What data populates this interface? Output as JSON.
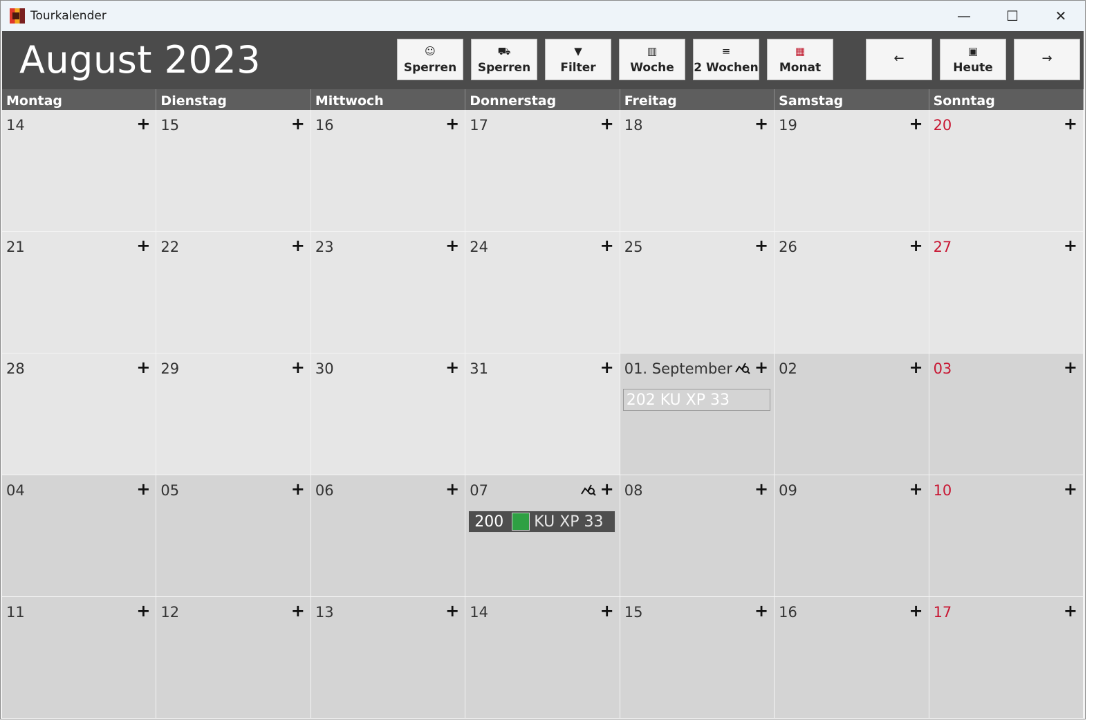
{
  "window": {
    "title": "Tourkalender",
    "controls": {
      "minimize": "—",
      "maximize": "☐",
      "close": "✕"
    }
  },
  "header": {
    "month_title": "August 2023"
  },
  "toolbar": {
    "buttons": [
      {
        "id": "sperren-driver",
        "icon": "person-face-icon",
        "glyph": "☺",
        "label": "Sperren"
      },
      {
        "id": "sperren-truck",
        "icon": "truck-icon",
        "glyph": "⛟",
        "label": "Sperren"
      },
      {
        "id": "filter",
        "icon": "filter-icon",
        "glyph": "▼",
        "label": "Filter"
      },
      {
        "id": "woche",
        "icon": "week-columns-icon",
        "glyph": "▥",
        "label": "Woche"
      },
      {
        "id": "2wochen",
        "icon": "two-weeks-rows-icon",
        "glyph": "≡",
        "label": "2 Wochen"
      },
      {
        "id": "monat",
        "icon": "month-grid-icon",
        "glyph": "▦",
        "label": "Monat",
        "icon_color": "#c0182c"
      }
    ],
    "nav": {
      "prev": {
        "glyph": "←",
        "icon": "arrow-left-icon"
      },
      "today": {
        "glyph": "▣",
        "icon": "calendar-today-icon",
        "label": "Heute"
      },
      "next": {
        "glyph": "→",
        "icon": "arrow-right-icon"
      }
    }
  },
  "weekdays": [
    "Montag",
    "Dienstag",
    "Mittwoch",
    "Donnerstag",
    "Freitag",
    "Samstag",
    "Sonntag"
  ],
  "colors": {
    "sunday": "#c81632",
    "event_swatch": "#2ea043"
  },
  "weeks": [
    [
      {
        "label": "14"
      },
      {
        "label": "15"
      },
      {
        "label": "16"
      },
      {
        "label": "17"
      },
      {
        "label": "18"
      },
      {
        "label": "19"
      },
      {
        "label": "20",
        "sunday": true
      }
    ],
    [
      {
        "label": "21"
      },
      {
        "label": "22"
      },
      {
        "label": "23"
      },
      {
        "label": "24"
      },
      {
        "label": "25"
      },
      {
        "label": "26"
      },
      {
        "label": "27",
        "sunday": true
      }
    ],
    [
      {
        "label": "28"
      },
      {
        "label": "29"
      },
      {
        "label": "30"
      },
      {
        "label": "31"
      },
      {
        "label": "01. September",
        "next": true,
        "route": true,
        "events": [
          {
            "style": "outline",
            "text": "202 KU XP 33"
          }
        ]
      },
      {
        "label": "02",
        "next": true
      },
      {
        "label": "03",
        "next": true,
        "sunday": true
      }
    ],
    [
      {
        "label": "04",
        "next": true
      },
      {
        "label": "05",
        "next": true
      },
      {
        "label": "06",
        "next": true
      },
      {
        "label": "07",
        "next": true,
        "route": true,
        "events": [
          {
            "style": "dark",
            "tour": "200",
            "plate": "KU XP 33",
            "swatch": "#2ea043"
          }
        ]
      },
      {
        "label": "08",
        "next": true
      },
      {
        "label": "09",
        "next": true
      },
      {
        "label": "10",
        "next": true,
        "sunday": true
      }
    ],
    [
      {
        "label": "11",
        "next": true
      },
      {
        "label": "12",
        "next": true
      },
      {
        "label": "13",
        "next": true
      },
      {
        "label": "14",
        "next": true
      },
      {
        "label": "15",
        "next": true
      },
      {
        "label": "16",
        "next": true
      },
      {
        "label": "17",
        "next": true,
        "sunday": true
      }
    ]
  ],
  "add_glyph": "+"
}
